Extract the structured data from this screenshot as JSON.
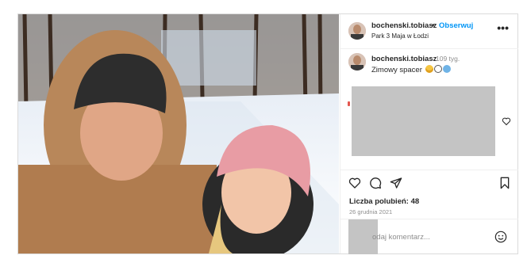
{
  "post": {
    "username": "bochenski.tobiasz",
    "separator": "•",
    "follow_label": "Obserwuj",
    "location": "Park 3 Maja w Łodzi",
    "more_label": "•••"
  },
  "caption": {
    "username": "bochenski.tobiasz",
    "time_ago": "109 tyg.",
    "text": "Zimowy spacer",
    "emojis": [
      "smiling-face-with-sunglasses",
      "snowman",
      "cold-face"
    ]
  },
  "actions": {
    "icons": [
      "heart-icon",
      "comment-icon",
      "share-icon",
      "bookmark-icon"
    ]
  },
  "likes_text": "Liczba polubień: 48",
  "date_text": "26 grudnia 2021",
  "comment_input": {
    "placeholder": "odaj komentarz..."
  },
  "colors": {
    "follow": "#0095f6",
    "text": "#262626",
    "muted": "#8e8e8e",
    "border": "#dbdbdb",
    "placeholder_box": "#c4c4c4"
  }
}
